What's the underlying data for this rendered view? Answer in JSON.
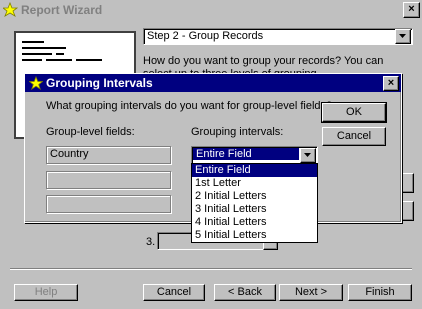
{
  "wizard": {
    "title": "Report Wizard",
    "close_glyph": "×",
    "step_select_value": "Step 2 - Group Records",
    "instruction": "How do you want to group your records? You can select up to three levels of grouping.",
    "group3_number": "3.",
    "buttons": {
      "help": "Help",
      "cancel": "Cancel",
      "back": "< Back",
      "next": "Next >",
      "finish": "Finish"
    }
  },
  "dialog": {
    "title": "Grouping Intervals",
    "close_glyph": "×",
    "question": "What grouping intervals do you want for group-level fields?",
    "col_group_level": "Group-level fields:",
    "col_grouping_intervals": "Grouping intervals:",
    "fields": [
      "Country",
      "",
      ""
    ],
    "interval_selected": "Entire Field",
    "interval_options": [
      "Entire Field",
      "1st Letter",
      "2 Initial Letters",
      "3 Initial Letters",
      "4 Initial Letters",
      "5 Initial Letters"
    ],
    "ok_label": "OK",
    "cancel_label": "Cancel"
  },
  "colors": {
    "titlebar_active": "#000080",
    "face": "#c0c0c0",
    "selection": "#000080"
  }
}
